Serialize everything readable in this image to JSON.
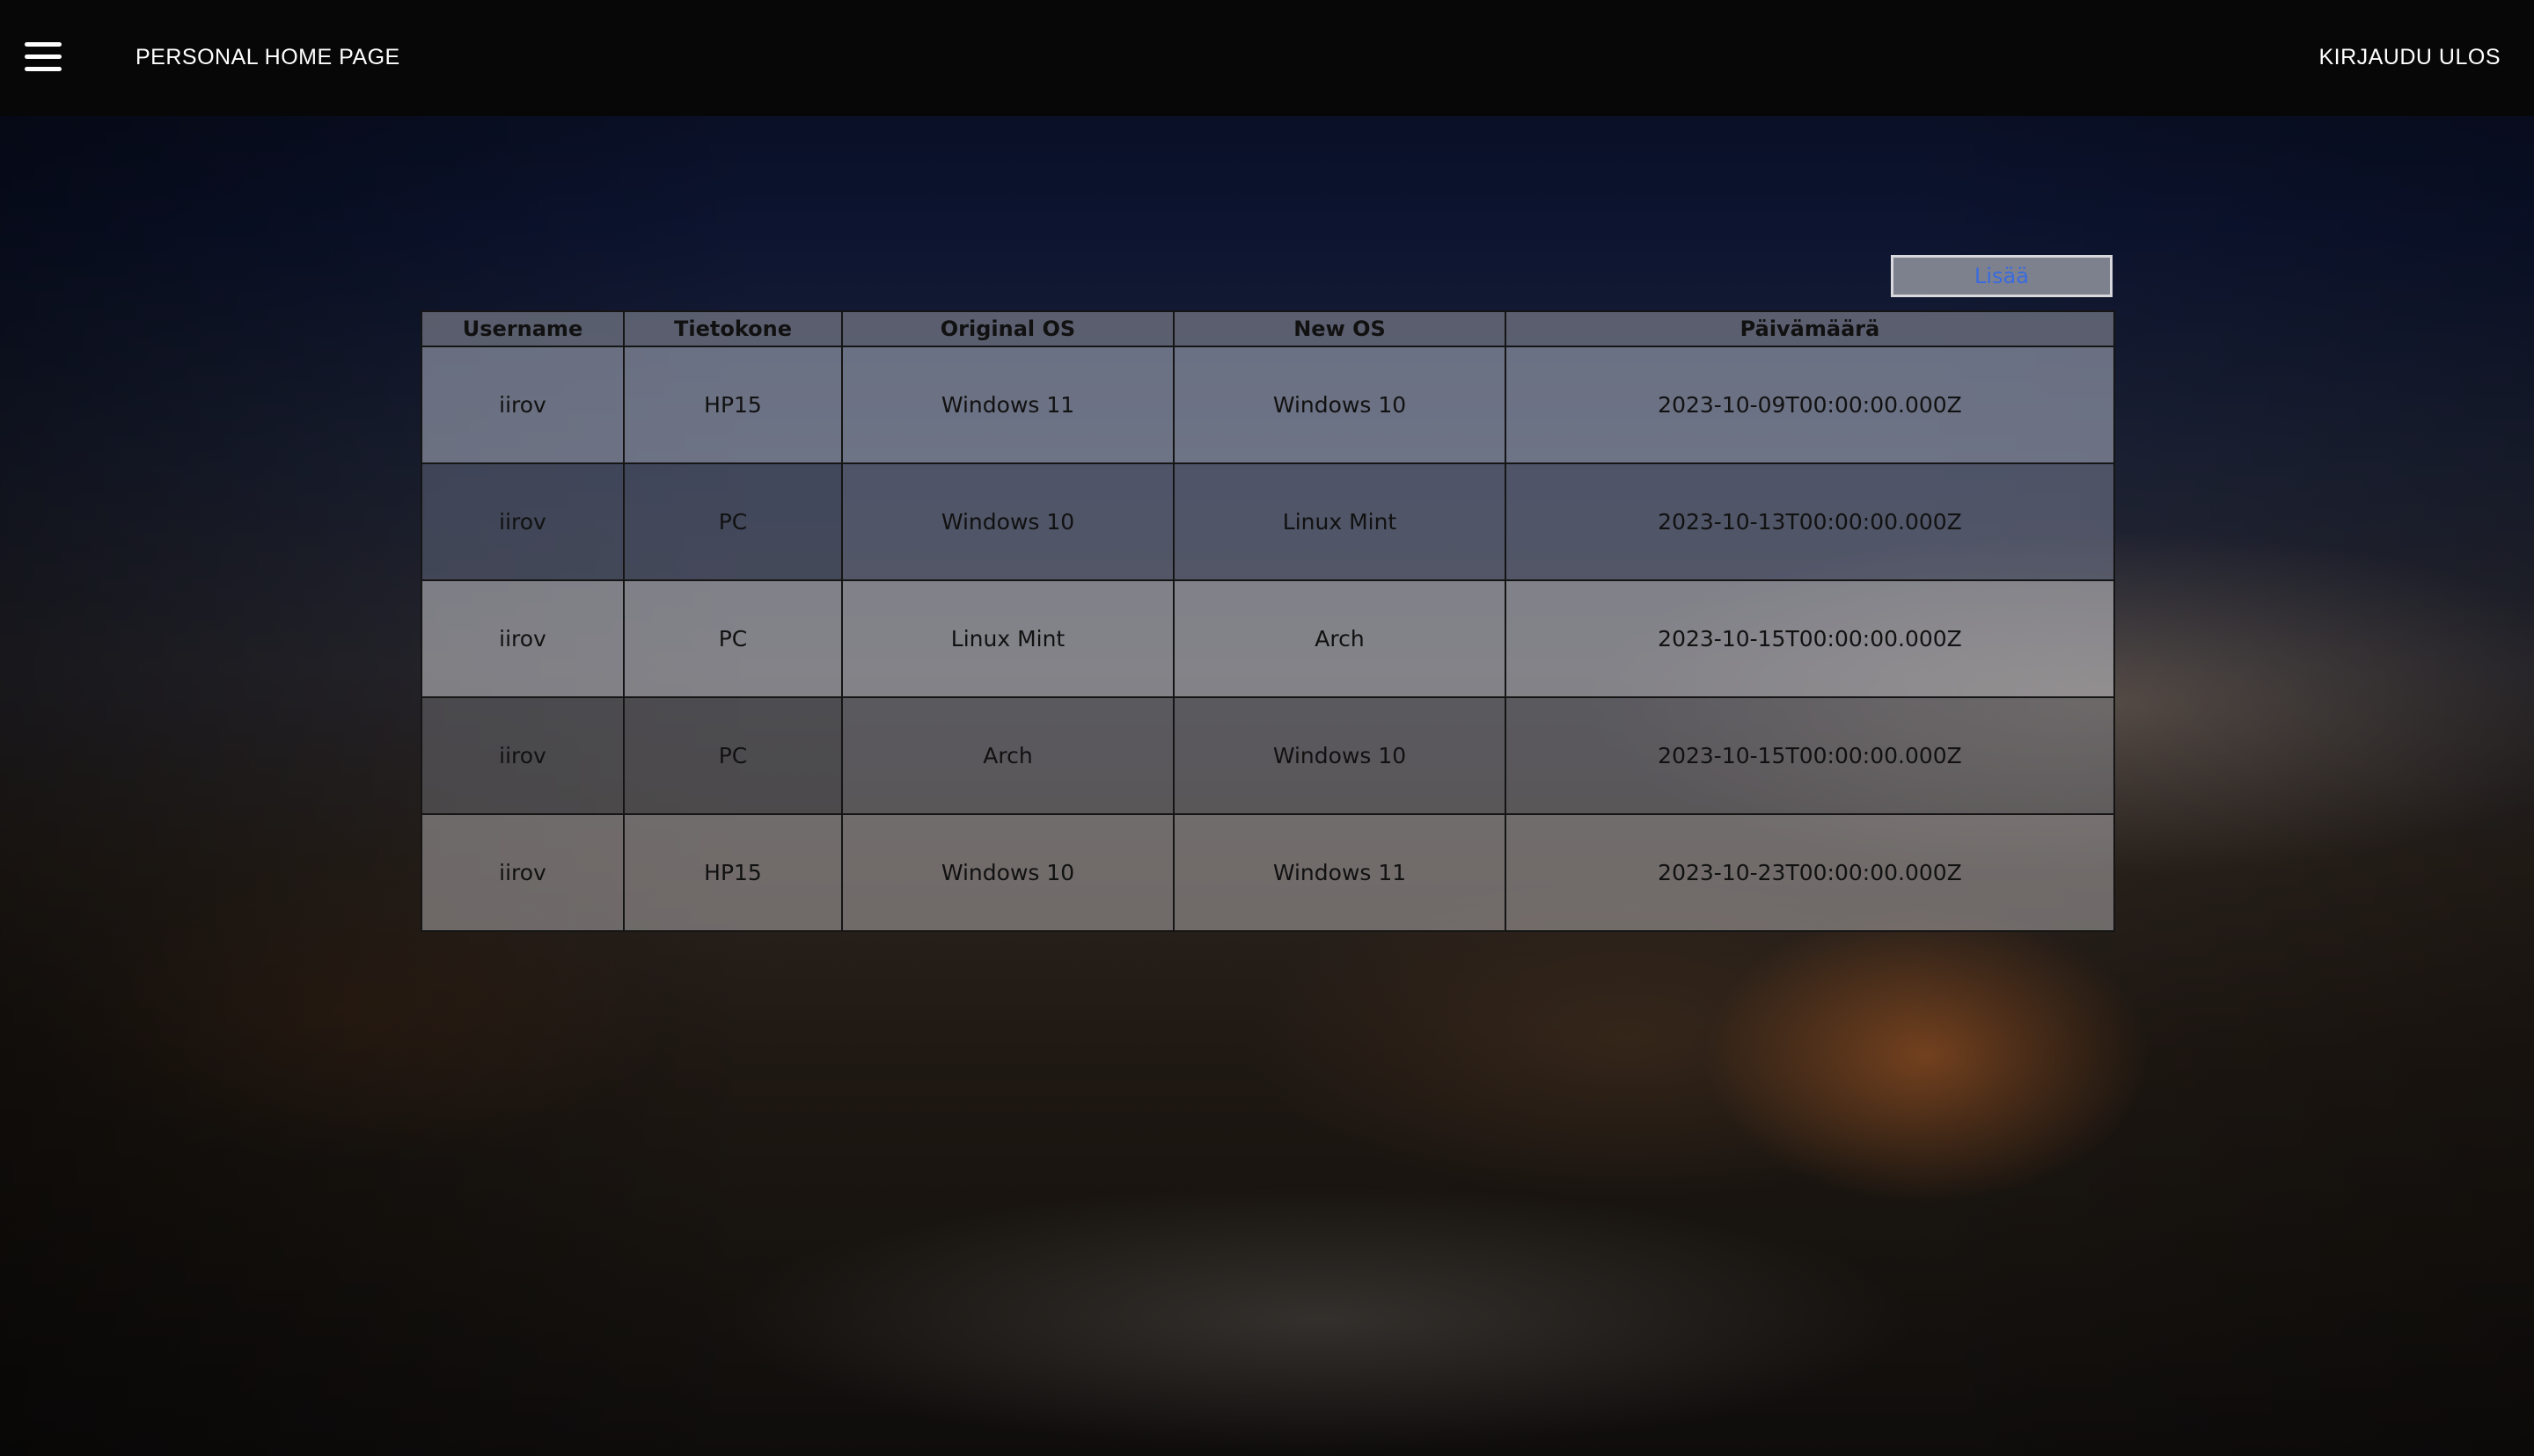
{
  "header": {
    "brand": "PERSONAL HOME PAGE",
    "logout": "KIRJAUDU ULOS"
  },
  "actions": {
    "add_label": "Lisää"
  },
  "table": {
    "columns": [
      "Username",
      "Tietokone",
      "Original OS",
      "New OS",
      "Päivämäärä"
    ],
    "rows": [
      [
        "iirov",
        "HP15",
        "Windows 11",
        "Windows 10",
        "2023-10-09T00:00:00.000Z"
      ],
      [
        "iirov",
        "PC",
        "Windows 10",
        "Linux Mint",
        "2023-10-13T00:00:00.000Z"
      ],
      [
        "iirov",
        "PC",
        "Linux Mint",
        "Arch",
        "2023-10-15T00:00:00.000Z"
      ],
      [
        "iirov",
        "PC",
        "Arch",
        "Windows 10",
        "2023-10-15T00:00:00.000Z"
      ],
      [
        "iirov",
        "HP15",
        "Windows 10",
        "Windows 11",
        "2023-10-23T00:00:00.000Z"
      ]
    ]
  },
  "colors": {
    "topbar": "#070707",
    "link_blue": "#3a6be0"
  }
}
